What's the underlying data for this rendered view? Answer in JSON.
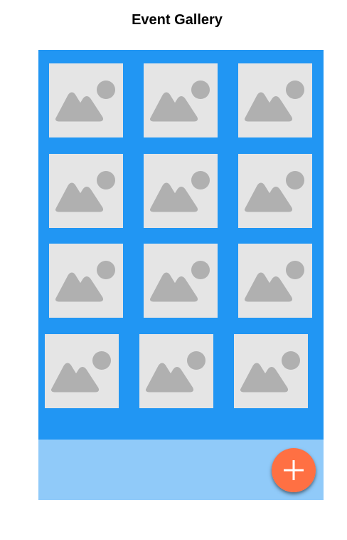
{
  "page": {
    "title": "Event Gallery"
  },
  "colors": {
    "gallery_background": "#2196f3",
    "footer_background": "#90caf9",
    "thumbnail_background": "#e5e5e5",
    "placeholder_glyph": "#b0b0b0",
    "fab_background": "#ff7043",
    "fab_icon": "#ffffff"
  },
  "gallery": {
    "columns": 3,
    "thumbnails": [
      {
        "icon": "image-placeholder-icon"
      },
      {
        "icon": "image-placeholder-icon"
      },
      {
        "icon": "image-placeholder-icon"
      },
      {
        "icon": "image-placeholder-icon"
      },
      {
        "icon": "image-placeholder-icon"
      },
      {
        "icon": "image-placeholder-icon"
      },
      {
        "icon": "image-placeholder-icon"
      },
      {
        "icon": "image-placeholder-icon"
      },
      {
        "icon": "image-placeholder-icon"
      },
      {
        "icon": "image-placeholder-icon"
      },
      {
        "icon": "image-placeholder-icon"
      },
      {
        "icon": "image-placeholder-icon"
      }
    ]
  },
  "fab": {
    "icon": "plus-icon"
  }
}
